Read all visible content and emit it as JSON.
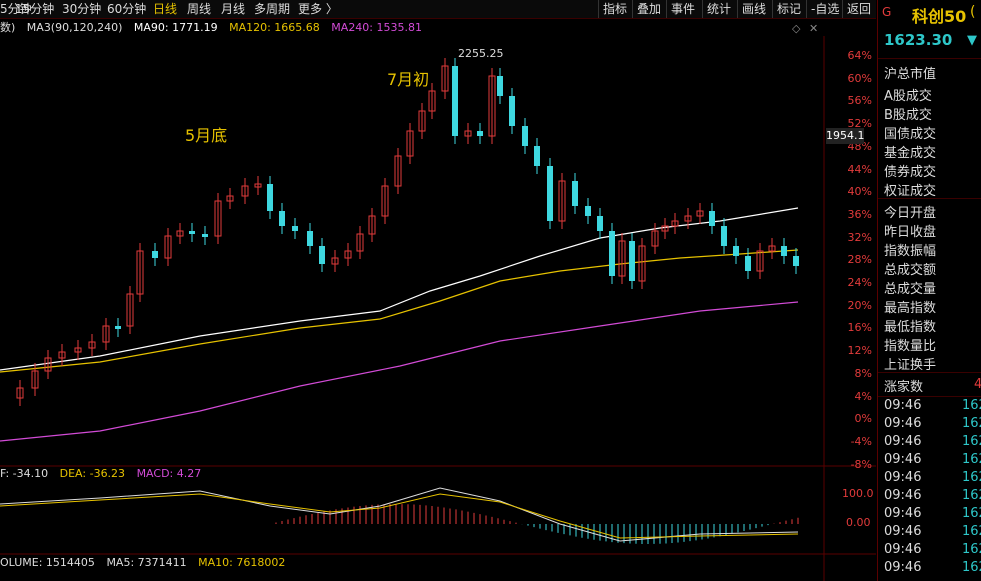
{
  "timeframes": [
    "5分钟",
    "15分钟",
    "30分钟",
    "60分钟",
    "日线",
    "周线",
    "月线",
    "多周期",
    "更多 〉"
  ],
  "active_timeframe": "日线",
  "toolbar": [
    "指标",
    "叠加",
    "事件",
    "统计",
    "画线",
    "标记",
    "-自选",
    "返回"
  ],
  "indicator_line": {
    "prefix": "数)",
    "ma_label": "MA3(90,120,240)",
    "ma90": "MA90: 1771.19",
    "ma120": "MA120: 1665.68",
    "ma240": "MA240: 1535.81"
  },
  "annotations": {
    "may_end": "5月底",
    "july_start": "7月初",
    "high": "2255.25"
  },
  "pct_axis": [
    "64%",
    "60%",
    "56%",
    "52%",
    "48%",
    "44%",
    "40%",
    "36%",
    "32%",
    "28%",
    "24%",
    "20%",
    "16%",
    "12%",
    "8%",
    "4%",
    "0%",
    "-4%",
    "-8%"
  ],
  "price_tag": "1954.1",
  "macd_line": {
    "dif": "F: -34.10",
    "dea": "DEA: -36.23",
    "macd": "MACD: 4.27"
  },
  "macd_axis": [
    "100.0",
    "0.00"
  ],
  "volume_line": {
    "volume": "OLUME: 1514405",
    "ma5": "MA5: 7371411",
    "ma10": "MA10: 7618002"
  },
  "right_panel": {
    "g_icon": "G",
    "name": "科创50",
    "name_suffix": "(",
    "price": "1623.30",
    "arrow": "▼",
    "items": [
      "沪总市值",
      "A股成交",
      "B股成交",
      "国债成交",
      "基金成交",
      "债券成交",
      "权证成交",
      "今日开盘",
      "昨日收盘",
      "指数振幅",
      "总成交额",
      "总成交量",
      "最高指数",
      "最低指数",
      "指数量比",
      "上证换手",
      "涨家数"
    ],
    "up_count_partial": "4",
    "ticks_time": [
      "09:46",
      "09:46",
      "09:46",
      "09:46",
      "09:46",
      "09:46",
      "09:46",
      "09:46",
      "09:46",
      "09:46"
    ],
    "ticks_val": [
      "162",
      "162",
      "162",
      "162",
      "162",
      "162",
      "162",
      "162",
      "162",
      "162"
    ]
  },
  "colors": {
    "up": "#e23b3b",
    "down": "#3ed8e0",
    "ma90": "#ffffff",
    "ma120": "#e6c200",
    "ma240": "#d24bd6"
  }
}
